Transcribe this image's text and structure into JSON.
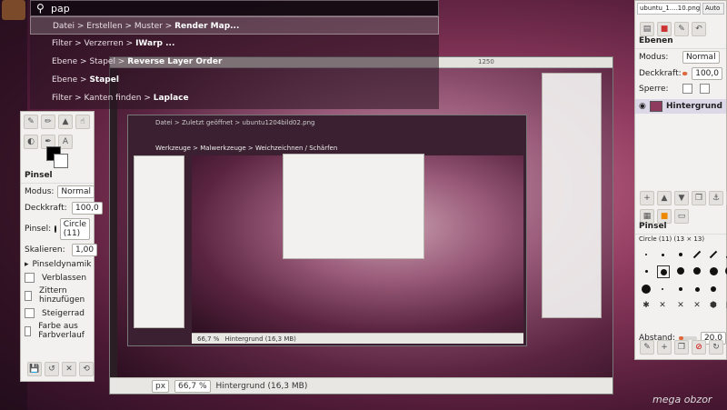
{
  "hud": {
    "query": "pap",
    "items": [
      {
        "path": "Datei > Erstellen > Muster > ",
        "hit": "Render Map...",
        "selected": true
      },
      {
        "path": "Filter > Verzerren > ",
        "hit": "IWarp ...",
        "selected": false
      },
      {
        "path": "Ebene > Stapel > ",
        "hit": "Reverse Layer Order",
        "selected": false
      },
      {
        "path": "Ebene > ",
        "hit": "Stapel",
        "selected": false
      },
      {
        "path": "Filter > Kanten finden > ",
        "hit": "Laplace",
        "selected": false
      }
    ]
  },
  "toolbox": {
    "section_title": "Pinsel",
    "modus_label": "Modus:",
    "modus_value": "Normal",
    "deckkraft_label": "Deckkraft:",
    "deckkraft_value": "100,0",
    "pinsel_label": "Pinsel:",
    "pinsel_value": "Circle (11)",
    "skalieren_label": "Skalieren:",
    "skalieren_value": "1,00",
    "dynamik_label": "Pinseldynamik",
    "options": [
      "Verblassen",
      "Zittern hinzufügen",
      "Steigerrad",
      "Farbe aus Farbverlauf"
    ]
  },
  "main_window": {
    "ruler_mark": "1250",
    "unit": "px",
    "zoom": "66,7 %",
    "status": "Hintergrund (16,3 MB)"
  },
  "inner_window": {
    "title": "Datei > Zuletzt geöffnet > ubuntu1204bild02.png",
    "hud_line": "Werkzeuge > Malwerkzeuge > Weichzeichnen / Schärfen",
    "zoom": "66,7 %",
    "status": "Hintergrund (16,3 MB)"
  },
  "tabs": {
    "tab1": "ubuntu_1....10.png-1",
    "tab2": "Auto"
  },
  "layers_panel": {
    "title": "Ebenen",
    "modus_label": "Modus:",
    "modus_value": "Normal",
    "deckkraft_label": "Deckkraft:",
    "deckkraft_value": "100,0",
    "sperre_label": "Sperre:",
    "layer_name": "Hintergrund"
  },
  "brushes_panel": {
    "title": "Pinsel",
    "current": "Circle (11) (13 × 13)",
    "abstand_label": "Abstand:",
    "abstand_value": "20,0"
  },
  "watermark": "mega obzor"
}
